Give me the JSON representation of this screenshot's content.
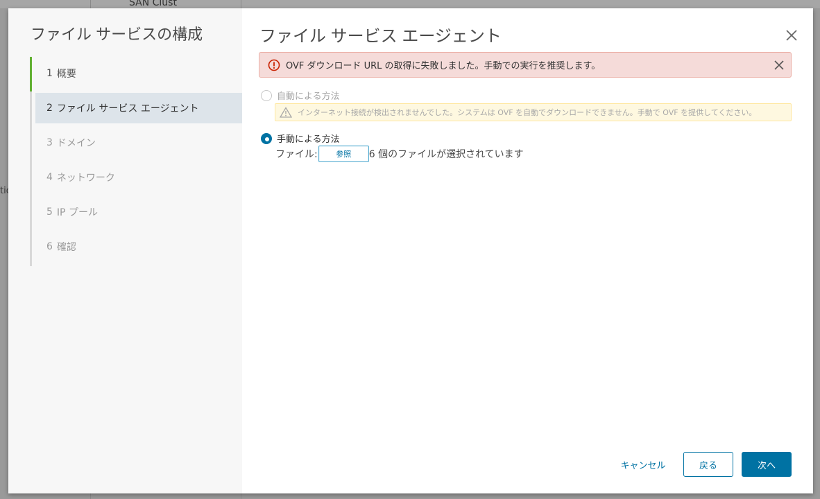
{
  "background": {
    "title_fragment": "SAN Clust",
    "left_fragment": "tio"
  },
  "nav": {
    "title": "ファイル サービスの構成",
    "steps": [
      {
        "num": "1",
        "label": "概要"
      },
      {
        "num": "2",
        "label": "ファイル サービス エージェント"
      },
      {
        "num": "3",
        "label": "ドメイン"
      },
      {
        "num": "4",
        "label": "ネットワーク"
      },
      {
        "num": "5",
        "label": "IP プール"
      },
      {
        "num": "6",
        "label": "確認"
      }
    ]
  },
  "content": {
    "title": "ファイル サービス エージェント",
    "error_message": "OVF ダウンロード URL の取得に失敗しました。手動での実行を推奨します。",
    "auto_option_label": "自動による方法",
    "warning_message": "インターネット接続が検出されませんでした。システムは OVF を自動でダウンロードできません。手動で OVF を提供してください。",
    "manual_option_label": "手動による方法",
    "file_label": "ファイル:",
    "browse_label": "参照",
    "file_status": "6 個のファイルが選択されています"
  },
  "footer": {
    "cancel_label": "キャンセル",
    "back_label": "戻る",
    "next_label": "次へ"
  },
  "colors": {
    "accent": "#0072a3",
    "progress_green": "#62b133",
    "error_bg": "#f5dbd9",
    "warning_bg": "#fef8e0"
  }
}
